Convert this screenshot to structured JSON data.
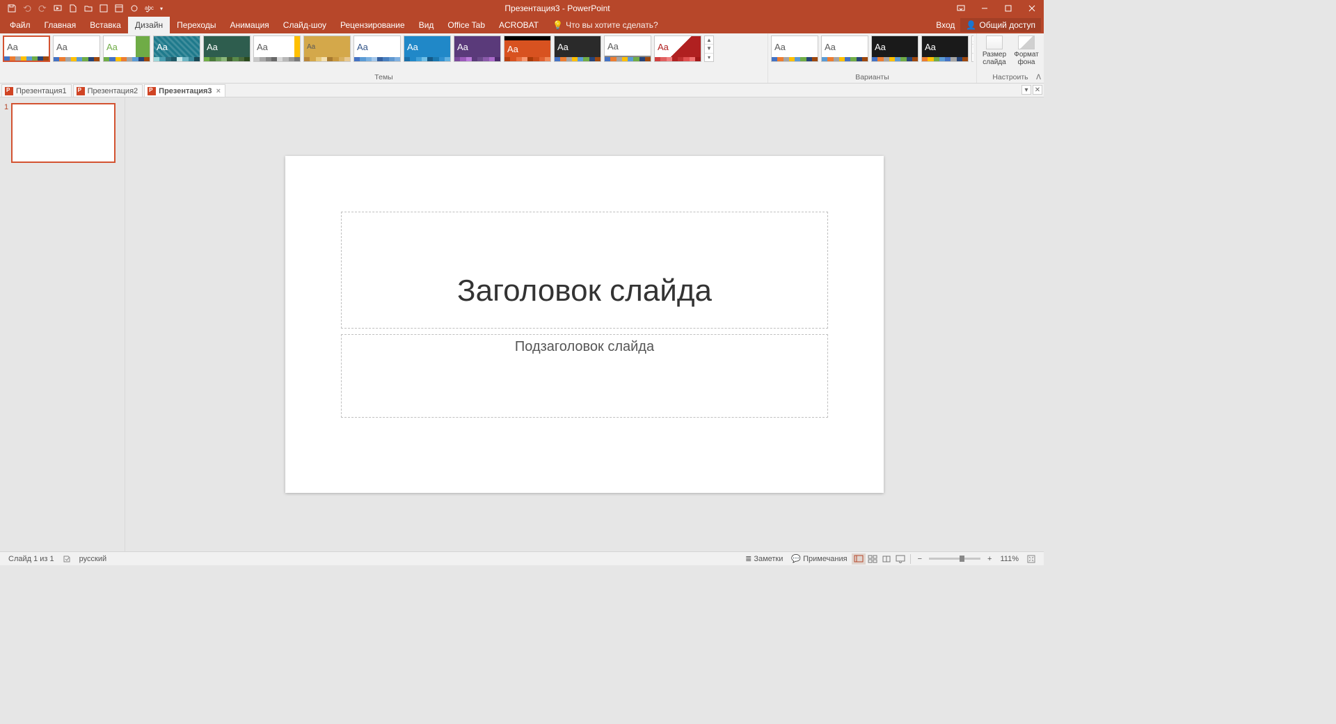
{
  "titlebar": {
    "title": "Презентация3 - PowerPoint"
  },
  "menutabs": {
    "file": "Файл",
    "home": "Главная",
    "insert": "Вставка",
    "design": "Дизайн",
    "transitions": "Переходы",
    "animations": "Анимация",
    "slideshow": "Слайд-шоу",
    "review": "Рецензирование",
    "view": "Вид",
    "officetab": "Office Tab",
    "acrobat": "ACROBAT",
    "tellme": "Что вы хотите сделать?"
  },
  "signin": "Вход",
  "share": "Общий доступ",
  "ribbon_groups": {
    "themes": "Темы",
    "variants": "Варианты",
    "customize": "Настроить"
  },
  "customize": {
    "size": "Размер слайда",
    "format": "Формат фона"
  },
  "doc_tabs": [
    {
      "label": "Презентация1",
      "active": false
    },
    {
      "label": "Презентация2",
      "active": false
    },
    {
      "label": "Презентация3",
      "active": true
    }
  ],
  "thumb_number": "1",
  "slide": {
    "title": "Заголовок слайда",
    "subtitle": "Подзаголовок слайда"
  },
  "statusbar": {
    "slidecount": "Слайд 1 из 1",
    "lang": "русский",
    "notes": "Заметки",
    "comments": "Примечания",
    "zoom": "111%"
  },
  "themes": [
    {
      "bg": "#ffffff",
      "fg": "#595959",
      "bar": [
        "#4472c4",
        "#ed7d31",
        "#a5a5a5",
        "#ffc000",
        "#5b9bd5",
        "#70ad47",
        "#264478",
        "#9e480e"
      ],
      "sel": true
    },
    {
      "bg": "#ffffff",
      "fg": "#595959",
      "bar": [
        "#4472c4",
        "#ed7d31",
        "#a5a5a5",
        "#ffc000",
        "#5b9bd5",
        "#70ad47",
        "#264478",
        "#9e480e"
      ]
    },
    {
      "bg": "#ffffff",
      "fg": "#6fac46",
      "bar": [
        "#70ad47",
        "#4472c4",
        "#ffc000",
        "#ed7d31",
        "#a5a5a5",
        "#5b9bd5",
        "#264478",
        "#9e480e"
      ],
      "accent": "right"
    },
    {
      "bg": "#1f7a8c",
      "fg": "#ffffff",
      "bar": [
        "#9ed8db",
        "#4a9eb0",
        "#2d6e7e",
        "#1f5a68",
        "#c8e8ea",
        "#6db5c4",
        "#3a8a9c",
        "#1a4a56"
      ],
      "pattern": true
    },
    {
      "bg": "#2e5d4e",
      "fg": "#ffffff",
      "bar": [
        "#70ad47",
        "#4a7a3a",
        "#6b9b5a",
        "#8bb87a",
        "#3a5a2e",
        "#5a8a4a",
        "#4a6a3a",
        "#2a4a1e"
      ]
    },
    {
      "bg": "#ffffff",
      "fg": "#595959",
      "bar": [
        "#c8c8c8",
        "#a8a8a8",
        "#888888",
        "#686868",
        "#d8d8d8",
        "#b8b8b8",
        "#989898",
        "#787878"
      ],
      "rightband": "#ffc000"
    },
    {
      "bg": "#d4a84a",
      "fg": "#595959",
      "bar": [
        "#b8863a",
        "#d4a84a",
        "#e8c878",
        "#f4e0b0",
        "#a87a30",
        "#c8983e",
        "#d8b060",
        "#e8c890"
      ],
      "small": true
    },
    {
      "bg": "#ffffff",
      "fg": "#335588",
      "bar": [
        "#4472c4",
        "#5b9bd5",
        "#7bb0e0",
        "#a4c8eb",
        "#3560a0",
        "#4a80c0",
        "#6098d0",
        "#80b0e0"
      ]
    },
    {
      "bg": "#2088c8",
      "fg": "#ffffff",
      "bar": [
        "#1a6ea8",
        "#2088c8",
        "#40a0d8",
        "#70c0e8",
        "#155a88",
        "#1a78b0",
        "#3090d0",
        "#60b0e0"
      ]
    },
    {
      "bg": "#5a3a7a",
      "fg": "#ffffff",
      "bar": [
        "#7a4a9a",
        "#9a5aba",
        "#ba7ada",
        "#5a3a7a",
        "#6a4a8a",
        "#8a5aaa",
        "#aa6aca",
        "#4a2a6a"
      ]
    },
    {
      "bg": "#d85220",
      "fg": "#ffffff",
      "bar": [
        "#b84210",
        "#d85220",
        "#e87040",
        "#f89870",
        "#a83a08",
        "#c84a18",
        "#e06030",
        "#f08858"
      ],
      "topband": "#000000"
    },
    {
      "bg": "#2a2a2a",
      "fg": "#ffffff",
      "bar": [
        "#4472c4",
        "#ed7d31",
        "#a5a5a5",
        "#ffc000",
        "#5b9bd5",
        "#70ad47",
        "#264478",
        "#9e480e"
      ]
    },
    {
      "bg": "#ffffff",
      "fg": "#595959",
      "bar": [
        "#4472c4",
        "#ed7d31",
        "#a5a5a5",
        "#ffc000",
        "#5b9bd5",
        "#70ad47",
        "#264478",
        "#9e480e"
      ],
      "underline": true
    },
    {
      "bg": "#ffffff",
      "fg": "#b02020",
      "bar": [
        "#d04040",
        "#e06060",
        "#f08080",
        "#b02020",
        "#c03030",
        "#e05050",
        "#f07070",
        "#a01818"
      ],
      "diag": true
    }
  ],
  "variants": [
    {
      "bg": "#ffffff",
      "bar": [
        "#4472c4",
        "#ed7d31",
        "#a5a5a5",
        "#ffc000",
        "#5b9bd5",
        "#70ad47",
        "#264478",
        "#9e480e"
      ]
    },
    {
      "bg": "#ffffff",
      "bar": [
        "#5b9bd5",
        "#ed7d31",
        "#a5a5a5",
        "#ffc000",
        "#4472c4",
        "#70ad47",
        "#264478",
        "#9e480e"
      ]
    },
    {
      "bg": "#1a1a1a",
      "bar": [
        "#4472c4",
        "#ed7d31",
        "#a5a5a5",
        "#ffc000",
        "#5b9bd5",
        "#70ad47",
        "#264478",
        "#9e480e"
      ]
    },
    {
      "bg": "#1a1a1a",
      "bar": [
        "#ed7d31",
        "#ffc000",
        "#70ad47",
        "#5b9bd5",
        "#4472c4",
        "#a5a5a5",
        "#264478",
        "#9e480e"
      ]
    }
  ]
}
